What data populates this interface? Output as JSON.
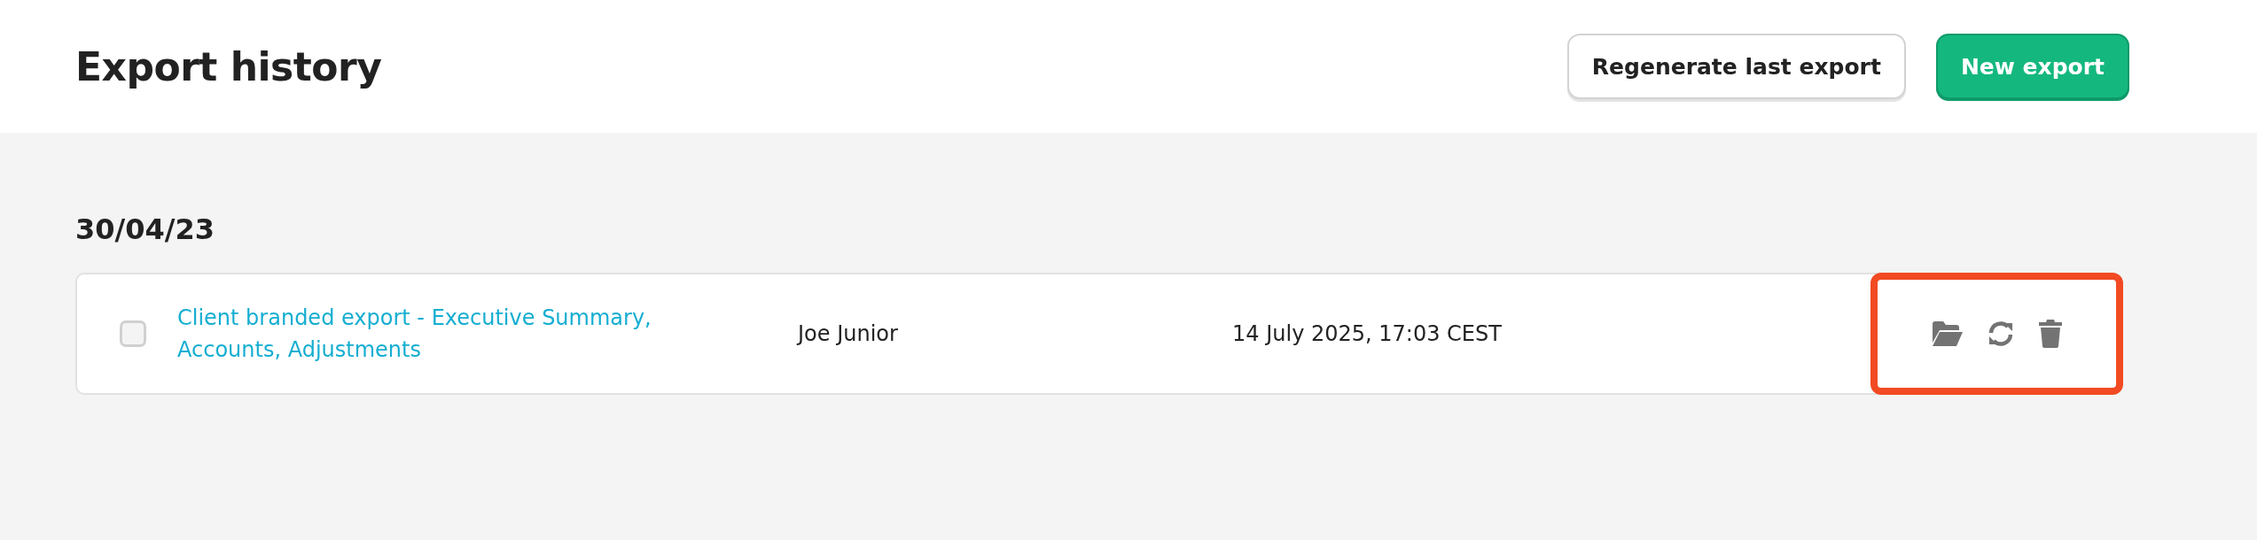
{
  "header": {
    "title": "Export history",
    "buttons": [
      {
        "label": "Regenerate last export",
        "kind": "secondary"
      },
      {
        "label": "New export",
        "kind": "primary"
      }
    ]
  },
  "groups": [
    {
      "date": "30/04/23",
      "rows": [
        {
          "checked": false,
          "name": "Client branded export - Executive Summary, Accounts, Adjustments",
          "author": "Joe Junior",
          "created": "14 July 2025, 17:03 CEST"
        }
      ]
    }
  ]
}
